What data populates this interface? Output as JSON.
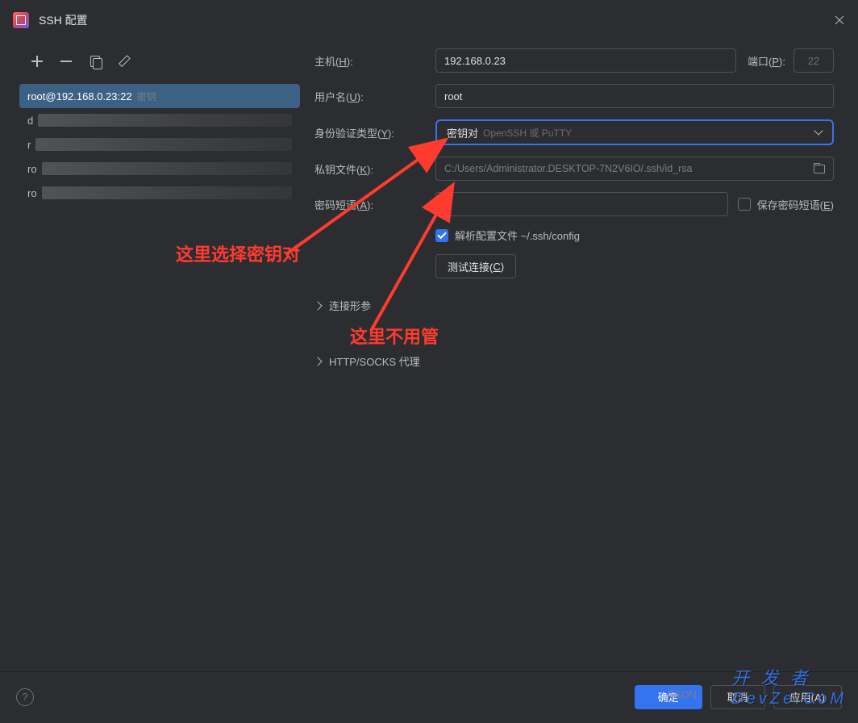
{
  "titlebar": {
    "title": "SSH 配置"
  },
  "sidebar": {
    "selected": {
      "text": "root@192.168.0.23:22",
      "meta": "密钥"
    },
    "items": [
      {
        "prefix": "d"
      },
      {
        "prefix": "r"
      },
      {
        "prefix": "ro"
      },
      {
        "prefix": "ro"
      }
    ]
  },
  "form": {
    "host_label_pre": "主机(",
    "host_label_u": "H",
    "host_label_post": "):",
    "host_value": "192.168.0.23",
    "port_label_pre": "端口(",
    "port_label_u": "P",
    "port_label_post": "):",
    "port_value": "22",
    "user_label_pre": "用户名(",
    "user_label_u": "U",
    "user_label_post": "):",
    "user_value": "root",
    "auth_label_pre": "身份验证类型(",
    "auth_label_u": "Y",
    "auth_label_post": "):",
    "auth_value": "密钥对",
    "auth_hint": "OpenSSH 或 PuTTY",
    "pk_label_pre": "私钥文件(",
    "pk_label_u": "K",
    "pk_label_post": "):",
    "pk_value": "C:/Users/Administrator.DESKTOP-7N2V6IO/.ssh/id_rsa",
    "pass_label_pre": "密码短语(",
    "pass_label_u": "A",
    "pass_label_post": "):",
    "save_pass_pre": "保存密码短语(",
    "save_pass_u": "E",
    "save_pass_post": ")",
    "parse_config": "解析配置文件 ~/.ssh/config",
    "test_conn_pre": "测试连接(",
    "test_conn_u": "C",
    "test_conn_post": ")",
    "section_conn": "连接形参",
    "section_proxy": "HTTP/SOCKS 代理"
  },
  "annotations": {
    "a1": "这里选择密钥对",
    "a2": "这里不用管"
  },
  "footer": {
    "ok": "确定",
    "cancel": "取消",
    "apply": "应用(A)"
  },
  "watermark": {
    "cn": "开 发 者",
    "en": "DevZe.CoM",
    "csdn": "CSDN"
  }
}
